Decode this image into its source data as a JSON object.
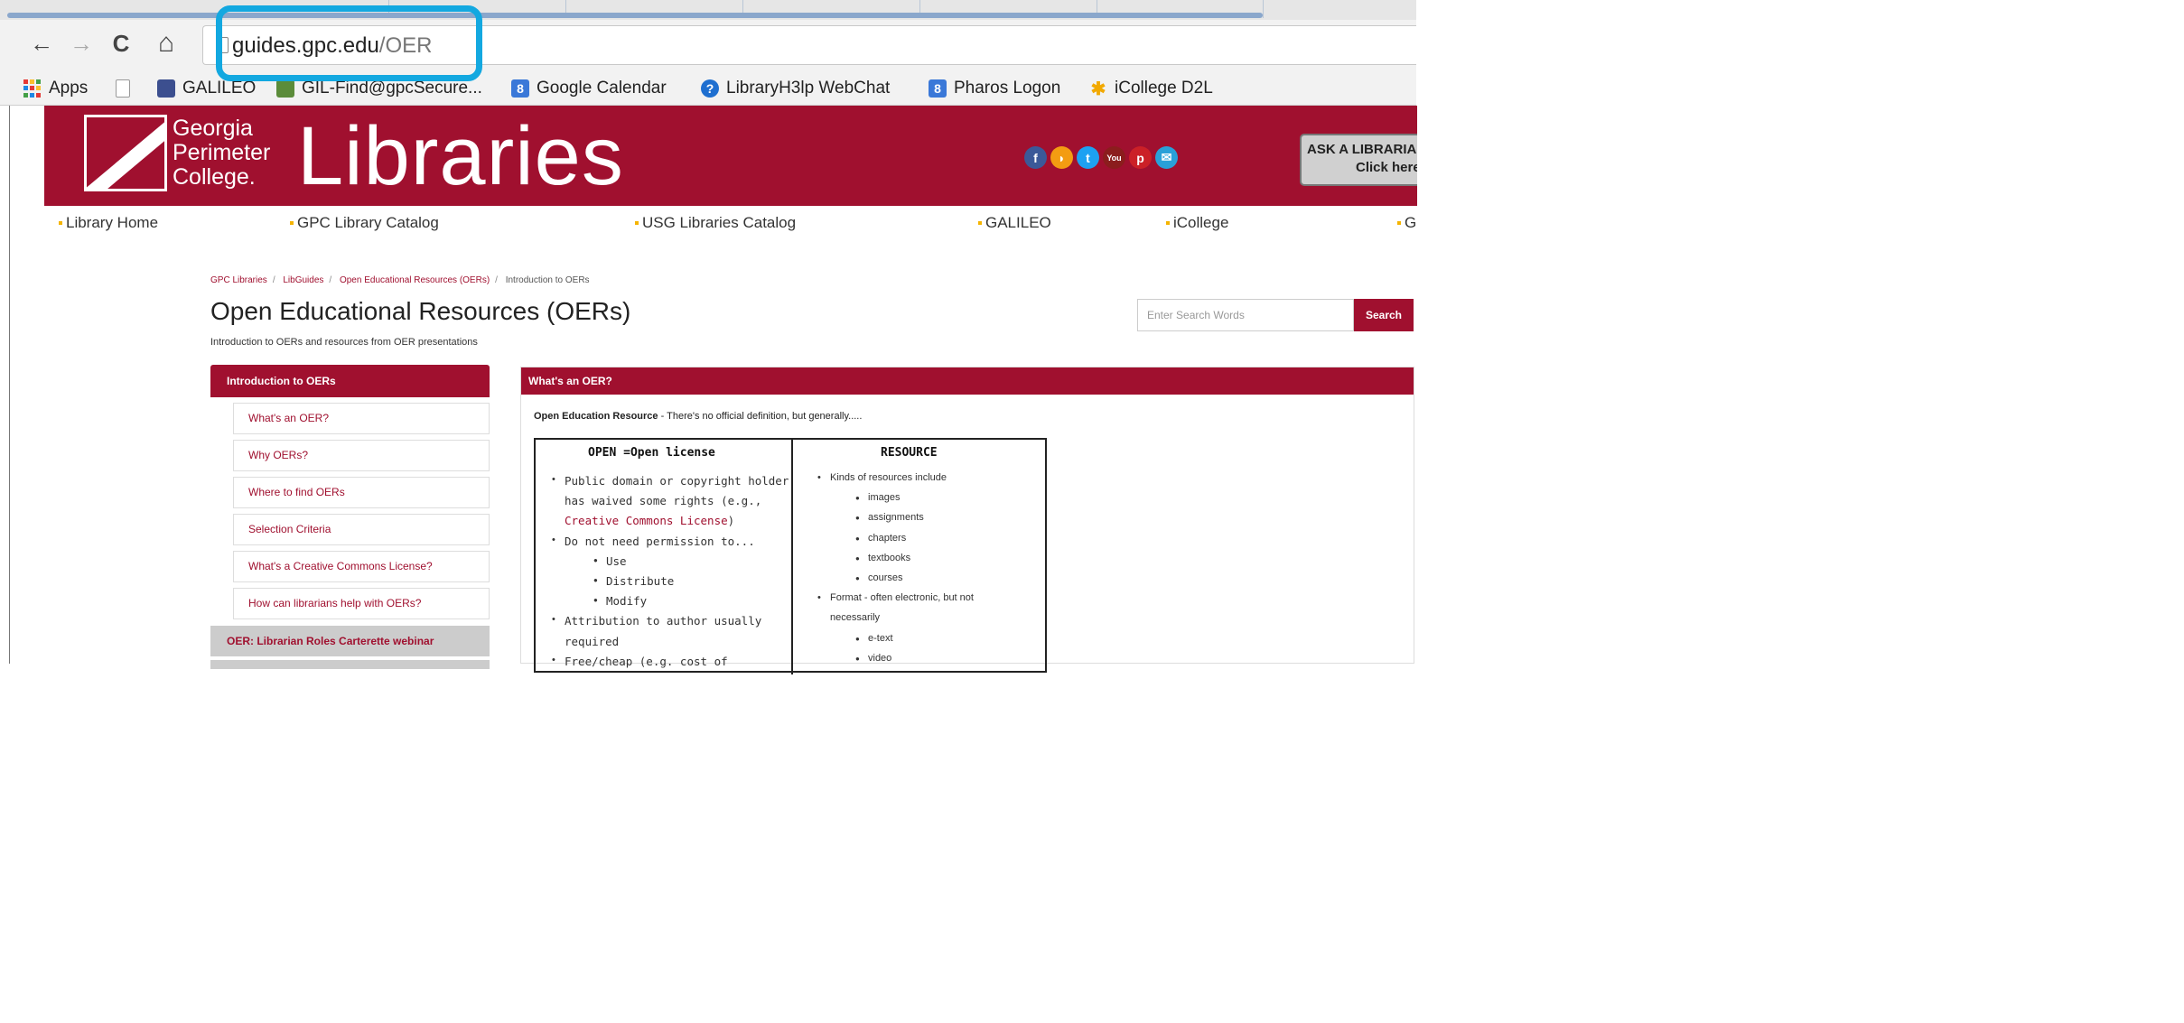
{
  "browser": {
    "url_host": "guides.gpc.edu",
    "url_path": "/OER",
    "nav": {
      "back": "←",
      "forward": "→",
      "reload": "C",
      "home": "⌂"
    },
    "bookmarks": [
      {
        "label": "Apps"
      },
      {
        "label": ""
      },
      {
        "label": "GALILEO"
      },
      {
        "label": "GIL-Find@gpcSecure..."
      },
      {
        "label": "Google Calendar"
      },
      {
        "label": "LibraryH3lp WebChat"
      },
      {
        "label": "Pharos Logon"
      },
      {
        "label": "iCollege D2L"
      }
    ]
  },
  "site": {
    "logo_lines": [
      "Georgia",
      "Perimeter",
      "College."
    ],
    "banner_title": "Libraries",
    "social_icons": [
      {
        "name": "facebook-icon",
        "glyph": "f",
        "color": "#3b5998"
      },
      {
        "name": "rss-icon",
        "glyph": "◗",
        "color": "#f39c12"
      },
      {
        "name": "twitter-icon",
        "glyph": "t",
        "color": "#1da1f2"
      },
      {
        "name": "youtube-icon",
        "glyph": "You",
        "color": "#8b1d1d"
      },
      {
        "name": "pinterest-icon",
        "glyph": "p",
        "color": "#cb2027"
      },
      {
        "name": "email-icon",
        "glyph": "✉",
        "color": "#2aa0d8"
      }
    ],
    "ask_line1": "ASK A LIBRARIA",
    "ask_line2": "Click here f",
    "topnav": [
      "Library Home",
      "GPC Library Catalog",
      "USG Libraries Catalog",
      "GALILEO",
      "iCollege",
      "G"
    ],
    "brand_color": "#a0102f"
  },
  "guide": {
    "breadcrumb": [
      "GPC Libraries",
      "LibGuides",
      "Open Educational Resources (OERs)",
      "Introduction to OERs"
    ],
    "title": "Open Educational Resources (OERs)",
    "description": "Introduction to OERs and resources from OER presentations",
    "search_placeholder": "Enter Search Words",
    "search_button": "Search",
    "sidebar": {
      "active": "Introduction to OERs",
      "subitems": [
        "What's an OER?",
        "Why OERs?",
        "Where to find OERs",
        "Selection Criteria",
        "What's a Creative Commons License?",
        "How can librarians help with OERs?"
      ],
      "other_pages": [
        "OER: Librarian Roles Carterette webinar",
        ""
      ]
    },
    "box": {
      "heading": "What's an OER?",
      "intro_bold": "Open Education Resource",
      "intro_rest": " - There's no official definition, but generally.....",
      "table": {
        "left_header": "OPEN =Open license",
        "right_header": "RESOURCE",
        "left_items": [
          {
            "text": "Public domain or copyright holder",
            "level": 1
          },
          {
            "text": "has waived some rights (e.g.,",
            "level": 1,
            "cont": true
          },
          {
            "text": "Creative Commons License",
            "level": 1,
            "cont": true,
            "link": true,
            "suffix": ")"
          },
          {
            "text": "Do not need permission to...",
            "level": 1
          },
          {
            "text": "Use",
            "level": 2
          },
          {
            "text": "Distribute",
            "level": 2
          },
          {
            "text": "Modify",
            "level": 2
          },
          {
            "text": "Attribution to author usually",
            "level": 1
          },
          {
            "text": "required",
            "level": 1,
            "cont": true
          },
          {
            "text": "Free/cheap (e.g. cost of",
            "level": 1
          }
        ],
        "right_items": [
          {
            "text": "Kinds of resources include",
            "level": 1
          },
          {
            "text": "images",
            "level": 2
          },
          {
            "text": "assignments",
            "level": 2
          },
          {
            "text": "chapters",
            "level": 2
          },
          {
            "text": "textbooks",
            "level": 2
          },
          {
            "text": "courses",
            "level": 2
          },
          {
            "text": "Format - often electronic, but not",
            "level": 1
          },
          {
            "text": "necessarily",
            "level": 1,
            "cont": true
          },
          {
            "text": "e-text",
            "level": 2
          },
          {
            "text": "video",
            "level": 2
          }
        ]
      }
    }
  }
}
